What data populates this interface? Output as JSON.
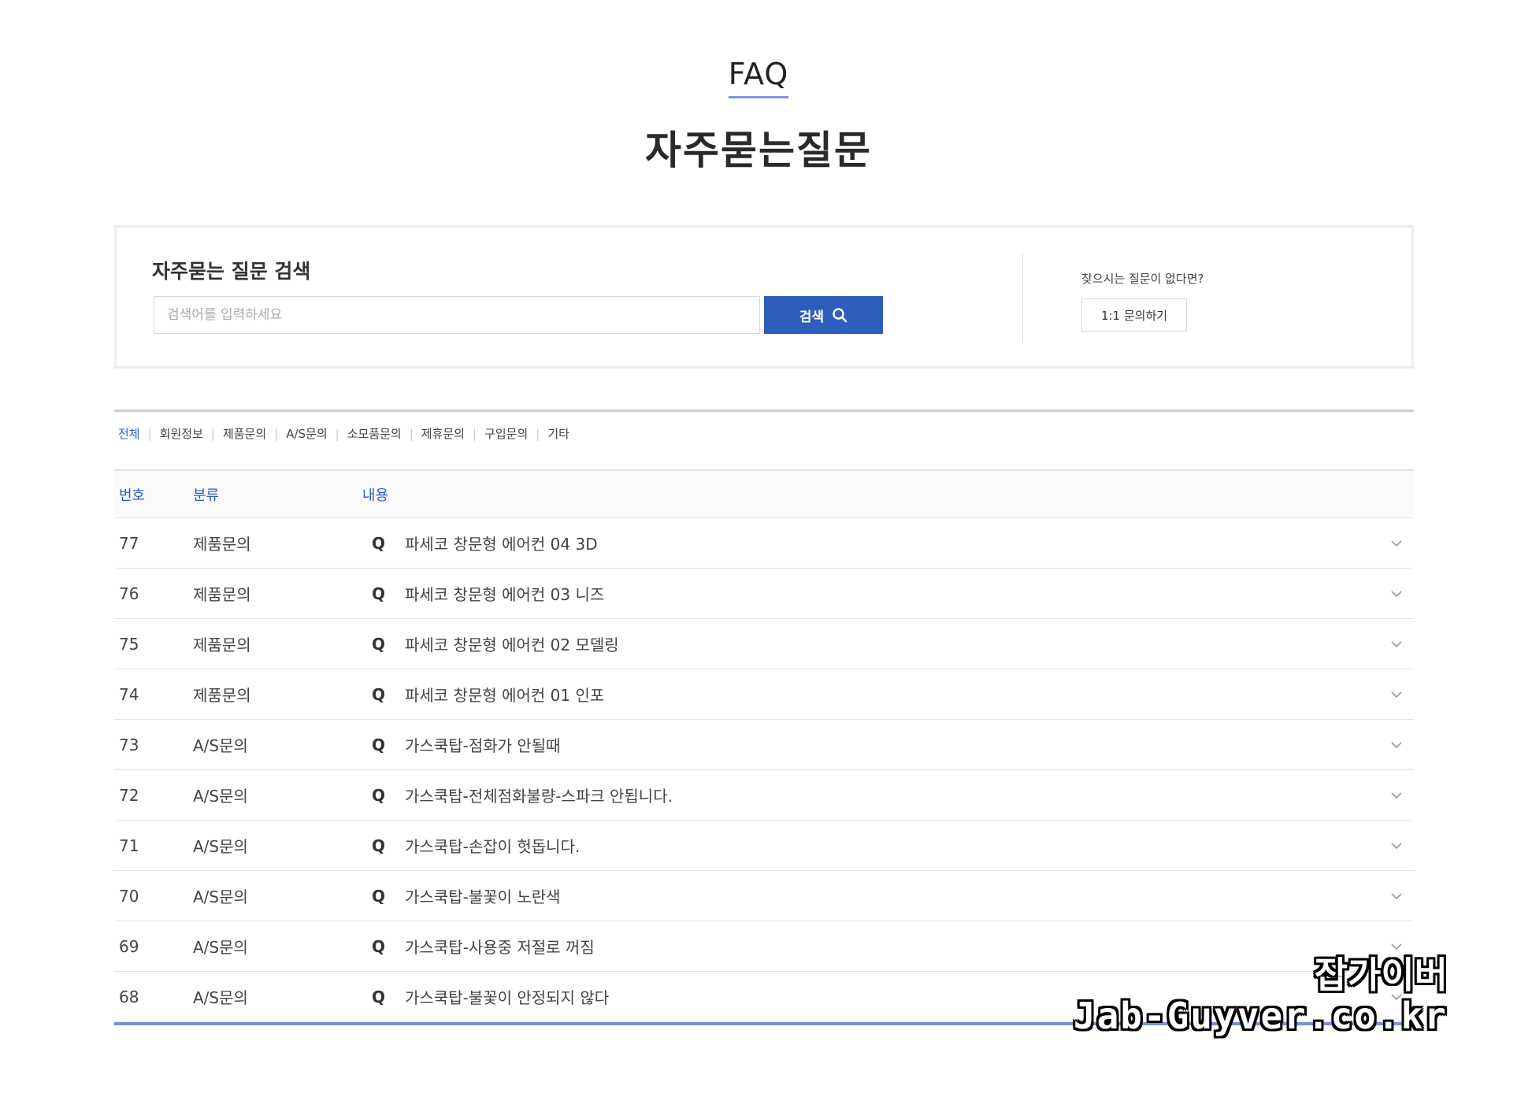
{
  "header": {
    "eyebrow": "FAQ",
    "title": "자주묻는질문"
  },
  "search": {
    "heading": "자주묻는 질문 검색",
    "placeholder": "검색어를 입력하세요",
    "value": "",
    "button_label": "검색",
    "button_icon": "search-icon",
    "no_question_text": "찾으시는 질문이 없다면?",
    "inquiry_button": "1:1 문의하기"
  },
  "tabs": [
    {
      "label": "전체",
      "active": true
    },
    {
      "label": "회원정보",
      "active": false
    },
    {
      "label": "제품문의",
      "active": false
    },
    {
      "label": "A/S문의",
      "active": false
    },
    {
      "label": "소모품문의",
      "active": false
    },
    {
      "label": "제휴문의",
      "active": false
    },
    {
      "label": "구입문의",
      "active": false
    },
    {
      "label": "기타",
      "active": false
    }
  ],
  "table": {
    "headers": {
      "num": "번호",
      "category": "분류",
      "content": "내용"
    },
    "q_mark": "Q",
    "rows": [
      {
        "num": "77",
        "category": "제품문의",
        "question": "파세코 창문형 에어컨 04 3D"
      },
      {
        "num": "76",
        "category": "제품문의",
        "question": "파세코 창문형 에어컨 03 니즈"
      },
      {
        "num": "75",
        "category": "제품문의",
        "question": "파세코 창문형 에어컨 02 모델링"
      },
      {
        "num": "74",
        "category": "제품문의",
        "question": "파세코 창문형 에어컨 01 인포"
      },
      {
        "num": "73",
        "category": "A/S문의",
        "question": "가스쿡탑-점화가 안될때"
      },
      {
        "num": "72",
        "category": "A/S문의",
        "question": "가스쿡탑-전체점화불량-스파크 안됩니다."
      },
      {
        "num": "71",
        "category": "A/S문의",
        "question": "가스쿡탑-손잡이 헛돕니다."
      },
      {
        "num": "70",
        "category": "A/S문의",
        "question": "가스쿡탑-불꽃이 노란색"
      },
      {
        "num": "69",
        "category": "A/S문의",
        "question": "가스쿡탑-사용중 저절로 꺼짐"
      },
      {
        "num": "68",
        "category": "A/S문의",
        "question": "가스쿡탑-불꽃이 안정되지 않다"
      }
    ]
  },
  "watermark": {
    "line1": "잡가이버",
    "line2": "Jab-Guyver.co.kr"
  },
  "colors": {
    "accent": "#2d5dbd",
    "underline": "#7f95e0",
    "border": "#e4e4e4"
  }
}
